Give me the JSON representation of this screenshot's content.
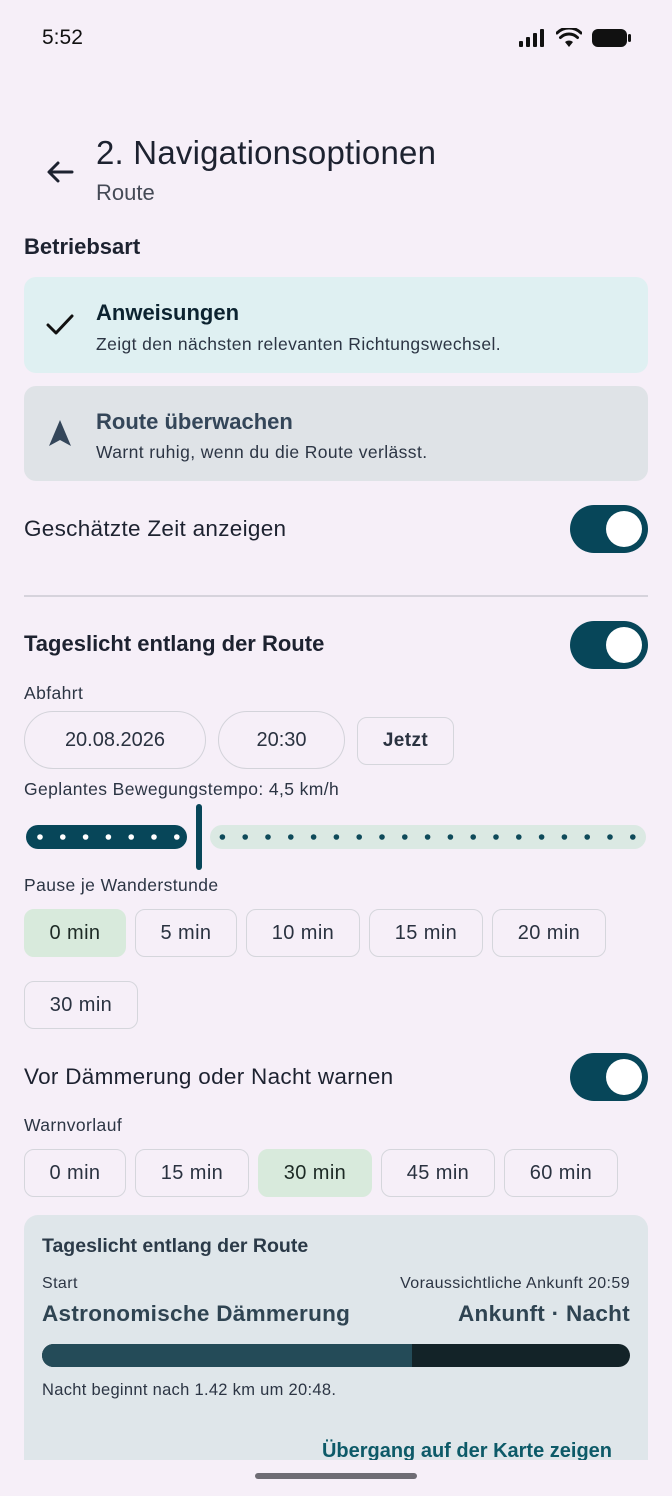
{
  "status_bar": {
    "time": "5:52"
  },
  "header": {
    "title": "2. Navigationsoptionen",
    "subtitle": "Route"
  },
  "mode": {
    "label": "Betriebsart",
    "options": [
      {
        "title": "Anweisungen",
        "description": "Zeigt den nächsten relevanten Richtungswechsel.",
        "selected": true,
        "icon": "check-icon"
      },
      {
        "title": "Route überwachen",
        "description": "Warnt ruhig, wenn du die Route verlässt.",
        "selected": false,
        "icon": "navigation-arrow-icon"
      }
    ]
  },
  "show_time": {
    "label": "Geschätzte Zeit anzeigen",
    "on": true
  },
  "daylight": {
    "label": "Tageslicht entlang der Route",
    "on": true,
    "departure_label": "Abfahrt",
    "date": "20.08.2026",
    "time": "20:30",
    "now_label": "Jetzt",
    "pace_label": "Geplantes Bewegungstempo: 4,5 km/h",
    "pace_fraction": 0.28,
    "pause_label": "Pause je Wanderstunde",
    "pause_options": [
      "0 min",
      "5 min",
      "10 min",
      "15 min",
      "20 min",
      "30 min"
    ],
    "pause_selected": "0 min"
  },
  "warn": {
    "label": "Vor Dämmerung oder Nacht warnen",
    "on": true,
    "lead_label": "Warnvorlauf",
    "lead_options": [
      "0 min",
      "15 min",
      "30 min",
      "45 min",
      "60 min"
    ],
    "lead_selected": "30 min"
  },
  "summary": {
    "title": "Tageslicht entlang der Route",
    "start_label": "Start",
    "start_value": "Astronomische Dämmerung",
    "arrival_label": "Voraussichtliche Ankunft 20:59",
    "arrival_value": "Ankunft · Nacht",
    "progress_fraction": 0.63,
    "note": "Nacht beginnt nach 1.42 km um 20:48.",
    "link": "Übergang auf der Karte zeigen"
  },
  "colors": {
    "accent": "#074659",
    "selected_card": "#dff0f2",
    "unselected_card": "#dfe3e7",
    "chip_selected": "#d8eadc"
  }
}
